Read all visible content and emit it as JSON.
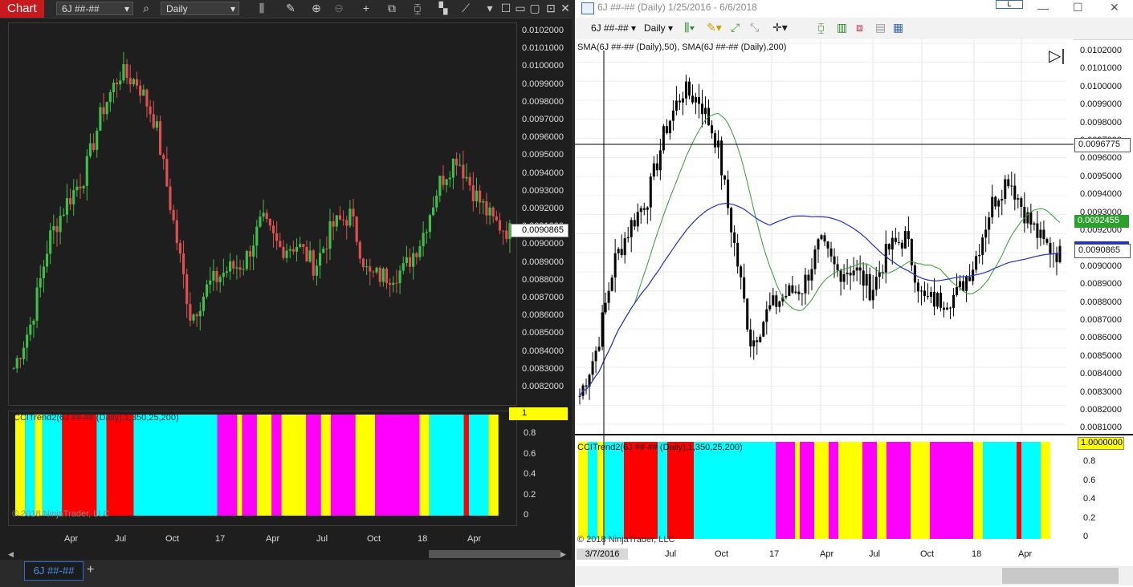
{
  "left": {
    "toolbar": {
      "tab_label": "Chart",
      "instrument": "6J ##-##",
      "interval": "Daily"
    },
    "price_axis": [
      "0.0102000",
      "0.0101000",
      "0.0100000",
      "0.0099000",
      "0.0098000",
      "0.0097000",
      "0.0096000",
      "0.0095000",
      "0.0094000",
      "0.0093000",
      "0.0092000",
      "0.0091000",
      "0.0090000",
      "0.0089000",
      "0.0088000",
      "0.0087000",
      "0.0086000",
      "0.0085000",
      "0.0084000",
      "0.0083000",
      "0.0082000"
    ],
    "last_price": "0.0090865",
    "indicator_label": "CCITrend2(6J ##-## (Daily),1,350,25,200)",
    "indicator_axis": [
      "0.8",
      "0.6",
      "0.4",
      "0.2",
      "0"
    ],
    "indicator_value": "1",
    "copyright": "© 2018 NinjaTrader, LLC",
    "date_axis": [
      "Apr",
      "Jul",
      "Oct",
      "17",
      "Apr",
      "Jul",
      "Oct",
      "18",
      "Apr"
    ],
    "bottom_tab": "6J ##-##",
    "add_tab": "+",
    "colors": {
      "up": "#3fbf4a",
      "down": "#e05050",
      "cyan": "#00ffff",
      "red": "#ff0000",
      "yellow": "#ffff00",
      "magenta": "#ff00ff",
      "accent": "#c8191e"
    }
  },
  "right": {
    "title": "6J ##-## (Daily)  1/25/2016 - 6/6/2018",
    "toolbar": {
      "instrument": "6J ##-##",
      "interval": "Daily"
    },
    "sma_label": "SMA(6J ##-## (Daily),50), SMA(6J ##-## (Daily),200)",
    "price_axis": [
      "0.0102000",
      "0.0101000",
      "0.0100000",
      "0.0099000",
      "0.0098000",
      "0.0097000",
      "0.0096000",
      "0.0095000",
      "0.0094000",
      "0.0093000",
      "0.0092000",
      "0.0091000",
      "0.0090000",
      "0.0089000",
      "0.0088000",
      "0.0087000",
      "0.0086000",
      "0.0085000",
      "0.0084000",
      "0.0083000",
      "0.0082000",
      "0.0081000"
    ],
    "crosshair_price": "0.0096775",
    "sma50_value": "0.0092455",
    "last_price": "0.0090865",
    "indicator_label": "CCITrend2(6J ##-## (Daily),1,350,25,200)",
    "indicator_axis": [
      "0.8",
      "0.6",
      "0.4",
      "0.2",
      "0"
    ],
    "indicator_value": "1.0000000",
    "copyright": "© 2018 NinjaTrader, LLC",
    "crosshair_date": "3/7/2016",
    "date_axis": [
      "Jul",
      "Oct",
      "17",
      "Apr",
      "Jul",
      "Oct",
      "18",
      "Apr"
    ],
    "colors": {
      "sma50": "#2ca02c",
      "sma200": "#1f2fd0",
      "cyan": "#00ffff",
      "red": "#ff0000",
      "yellow": "#ffff00",
      "magenta": "#ff00ff"
    }
  },
  "chart_data": {
    "type": "candlestick",
    "title": "",
    "price_range": [
      0.00815,
      0.01022
    ],
    "close_points": [
      {
        "t": "2016-02",
        "v": 0.00835
      },
      {
        "t": "2016-03",
        "v": 0.0086
      },
      {
        "t": "2016-04",
        "v": 0.00905
      },
      {
        "t": "2016-05",
        "v": 0.00925
      },
      {
        "t": "2016-06",
        "v": 0.0094
      },
      {
        "t": "2016-07",
        "v": 0.00975
      },
      {
        "t": "2016-08",
        "v": 0.00995
      },
      {
        "t": "2016-09",
        "v": 0.0099
      },
      {
        "t": "2016-10",
        "v": 0.00968
      },
      {
        "t": "2016-11",
        "v": 0.00915
      },
      {
        "t": "2016-12",
        "v": 0.00862
      },
      {
        "t": "2017-01",
        "v": 0.0088
      },
      {
        "t": "2017-02",
        "v": 0.00888
      },
      {
        "t": "2017-03",
        "v": 0.00892
      },
      {
        "t": "2017-04",
        "v": 0.00915
      },
      {
        "t": "2017-05",
        "v": 0.009
      },
      {
        "t": "2017-06",
        "v": 0.00902
      },
      {
        "t": "2017-07",
        "v": 0.0089
      },
      {
        "t": "2017-08",
        "v": 0.00912
      },
      {
        "t": "2017-09",
        "v": 0.00918
      },
      {
        "t": "2017-10",
        "v": 0.00885
      },
      {
        "t": "2017-11",
        "v": 0.00885
      },
      {
        "t": "2017-12",
        "v": 0.00888
      },
      {
        "t": "2018-01",
        "v": 0.00905
      },
      {
        "t": "2018-02",
        "v": 0.00935
      },
      {
        "t": "2018-03",
        "v": 0.0095
      },
      {
        "t": "2018-04",
        "v": 0.0093
      },
      {
        "t": "2018-05",
        "v": 0.00915
      },
      {
        "t": "2018-06",
        "v": 0.00909
      }
    ]
  }
}
